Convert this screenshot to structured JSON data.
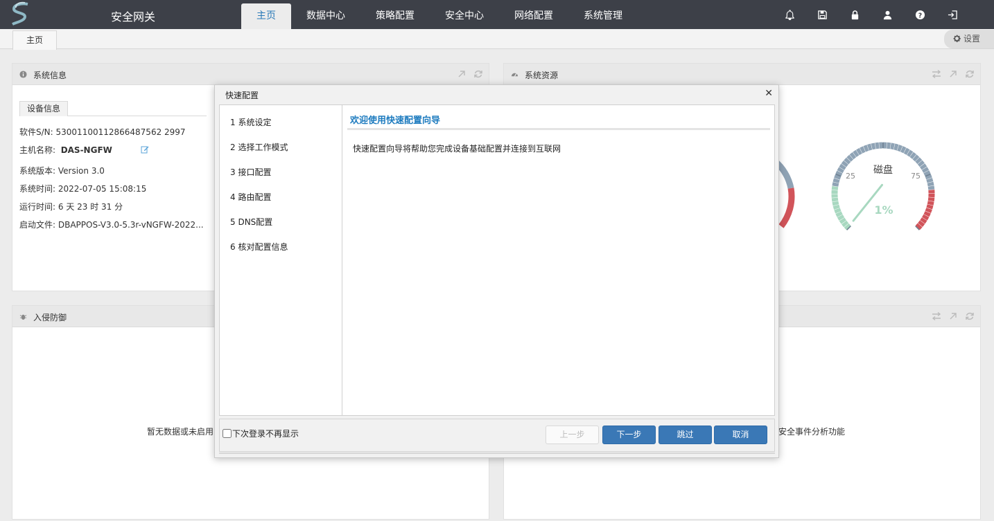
{
  "app": {
    "title": "安全网关"
  },
  "nav": {
    "items": [
      {
        "label": "主页"
      },
      {
        "label": "数据中心"
      },
      {
        "label": "策略配置"
      },
      {
        "label": "安全中心"
      },
      {
        "label": "网络配置"
      },
      {
        "label": "系统管理"
      }
    ],
    "active": "主页"
  },
  "top_icons": [
    "bell-icon",
    "save-icon",
    "lock-icon",
    "user-icon",
    "help-icon",
    "logout-icon"
  ],
  "tabs": {
    "home": "主页",
    "settings": "设置"
  },
  "sysinfo": {
    "title": "系统信息",
    "device_tab": "设备信息",
    "serial_label": "软件S/N:",
    "serial_value": "53001100112866487562 2997",
    "hostname_label": "主机名称:",
    "hostname_value": "DAS-NGFW",
    "version_label": "系统版本:",
    "version_value": "Version 3.0",
    "time_label": "系统时间:",
    "time_value": "2022-07-05 15:08:15",
    "uptime_label": "运行时间:",
    "uptime_value": "6 天 23 时 31 分",
    "boot_label": "启动文件:",
    "boot_value": "DBAPPOS-V3.0-5.3r-vNGFW-2022..."
  },
  "resources": {
    "title": "系统资源",
    "disk": {
      "label": "磁盘",
      "tick_25": "25",
      "tick_75": "75",
      "value_text": "1%",
      "percent": 1
    }
  },
  "intrusion": {
    "title": "入侵防御",
    "empty_text": "暂无数据或未启用"
  },
  "events": {
    "empty_text": "安全事件分析功能"
  },
  "modal": {
    "title": "快速配置",
    "steps": [
      "1 系统设定",
      "2 选择工作模式",
      "3 接口配置",
      "4 路由配置",
      "5 DNS配置",
      "6 核对配置信息"
    ],
    "header": "欢迎使用快速配置向导",
    "description": "快速配置向导将帮助您完成设备基础配置并连接到互联网",
    "dont_show": "下次登录不再显示",
    "prev": "上一步",
    "next": "下一步",
    "skip": "跳过",
    "cancel": "取消"
  },
  "colors": {
    "topbar": "#3d4048",
    "accent": "#2a7ab8",
    "button": "#3a78b6"
  }
}
